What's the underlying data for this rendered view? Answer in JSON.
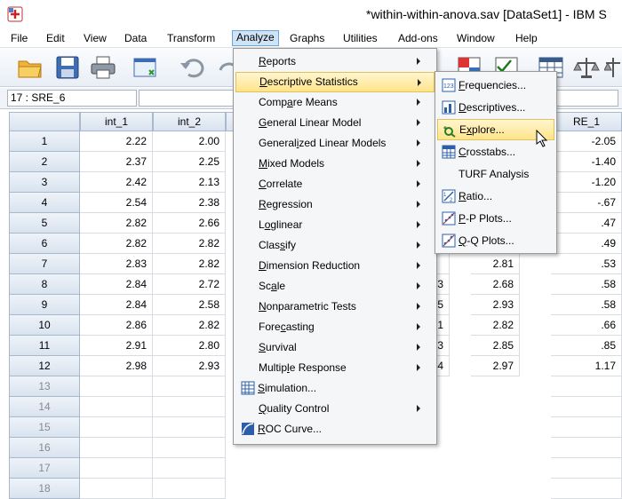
{
  "window": {
    "title": "*within-within-anova.sav [DataSet1] - IBM S"
  },
  "menubar": [
    {
      "label": "File",
      "key": "file"
    },
    {
      "label": "Edit",
      "key": "edit"
    },
    {
      "label": "View",
      "key": "view"
    },
    {
      "label": "Data",
      "key": "data"
    },
    {
      "label": "Transform",
      "key": "transform"
    },
    {
      "label": "Analyze",
      "key": "analyze",
      "active": true
    },
    {
      "label": "Graphs",
      "key": "graphs"
    },
    {
      "label": "Utilities",
      "key": "utilities"
    },
    {
      "label": "Add-ons",
      "key": "add-ons"
    },
    {
      "label": "Window",
      "key": "window"
    },
    {
      "label": "Help",
      "key": "help"
    }
  ],
  "cell_reference": "17 : SRE_6",
  "columns": [
    "int_1",
    "int_2",
    "RE_1"
  ],
  "rows": [
    {
      "n": "1",
      "int_1": "2.22",
      "int_2": "2.00",
      "re": "-2.05"
    },
    {
      "n": "2",
      "int_1": "2.37",
      "int_2": "2.25",
      "re": "-1.40"
    },
    {
      "n": "3",
      "int_1": "2.42",
      "int_2": "2.13",
      "re": "-1.20"
    },
    {
      "n": "4",
      "int_1": "2.54",
      "int_2": "2.38",
      "re": "-.67"
    },
    {
      "n": "5",
      "int_1": "2.82",
      "int_2": "2.66",
      "re": ".47"
    },
    {
      "n": "6",
      "int_1": "2.82",
      "int_2": "2.82",
      "re": ".49"
    },
    {
      "n": "7",
      "int_1": "2.83",
      "int_2": "2.82",
      "partial_a": "",
      "partial_b": "2.81",
      "re": ".53"
    },
    {
      "n": "8",
      "int_1": "2.84",
      "int_2": "2.72",
      "partial_a": "3",
      "partial_b": "2.68",
      "re": ".58"
    },
    {
      "n": "9",
      "int_1": "2.84",
      "int_2": "2.58",
      "partial_a": "5",
      "partial_b": "2.93",
      "re": ".58"
    },
    {
      "n": "10",
      "int_1": "2.86",
      "int_2": "2.82",
      "partial_a": "1",
      "partial_b": "2.82",
      "re": ".66"
    },
    {
      "n": "11",
      "int_1": "2.91",
      "int_2": "2.80",
      "partial_a": "3",
      "partial_b": "2.85",
      "re": ".85"
    },
    {
      "n": "12",
      "int_1": "2.98",
      "int_2": "2.93",
      "partial_a": "4",
      "partial_b": "2.97",
      "re": "1.17"
    }
  ],
  "empty_rows": [
    "13",
    "14",
    "15",
    "16",
    "17",
    "18"
  ],
  "analyze_menu": [
    {
      "label": "Reports",
      "submenu": true
    },
    {
      "label": "Descriptive Statistics",
      "submenu": true,
      "selected": true
    },
    {
      "label": "Compare Means",
      "submenu": true
    },
    {
      "label": "General Linear Model",
      "submenu": true
    },
    {
      "label": "Generalized Linear Models",
      "submenu": true
    },
    {
      "label": "Mixed Models",
      "submenu": true
    },
    {
      "label": "Correlate",
      "submenu": true
    },
    {
      "label": "Regression",
      "submenu": true
    },
    {
      "label": "Loglinear",
      "submenu": true
    },
    {
      "label": "Classify",
      "submenu": true
    },
    {
      "label": "Dimension Reduction",
      "submenu": true
    },
    {
      "label": "Scale",
      "submenu": true
    },
    {
      "label": "Nonparametric Tests",
      "submenu": true
    },
    {
      "label": "Forecasting",
      "submenu": true
    },
    {
      "label": "Survival",
      "submenu": true
    },
    {
      "label": "Multiple Response",
      "submenu": true
    },
    {
      "label": "Simulation...",
      "submenu": false,
      "icon": "simulation-icon"
    },
    {
      "label": "Quality Control",
      "submenu": true
    },
    {
      "label": "ROC Curve...",
      "submenu": false,
      "icon": "roc-curve-icon"
    }
  ],
  "descriptives_submenu": [
    {
      "label": "Frequencies...",
      "icon": "frequencies-icon"
    },
    {
      "label": "Descriptives...",
      "icon": "descriptives-icon"
    },
    {
      "label": "Explore...",
      "icon": "explore-icon",
      "selected": true
    },
    {
      "label": "Crosstabs...",
      "icon": "crosstabs-icon"
    },
    {
      "label": "TURF Analysis",
      "icon": ""
    },
    {
      "label": "Ratio...",
      "icon": "ratio-icon"
    },
    {
      "label": "P-P Plots...",
      "icon": "pp-plots-icon"
    },
    {
      "label": "Q-Q Plots...",
      "icon": "qq-plots-icon"
    }
  ],
  "colors": {
    "menu_selected": "#ffe48a",
    "menubar_active": "#cfe3f7",
    "header_blue": "#d9e3ef"
  }
}
